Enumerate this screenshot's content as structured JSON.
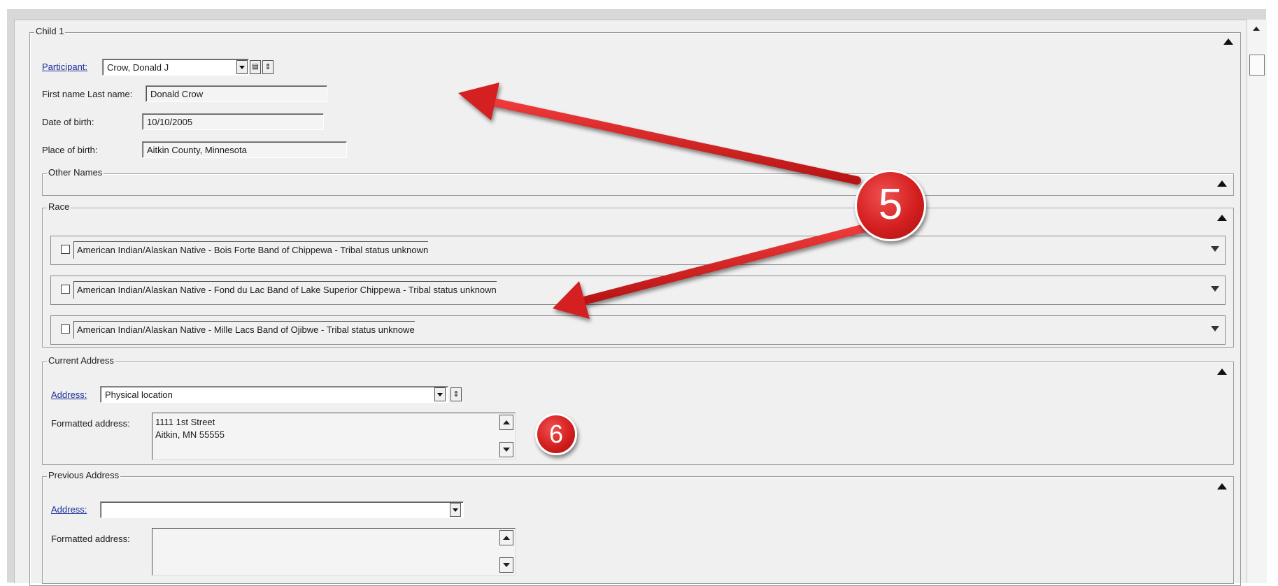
{
  "child": {
    "title": "Child 1",
    "participant": {
      "label": "Participant:",
      "value": "Crow, Donald J"
    },
    "name": {
      "label": "First name Last name:",
      "value": "Donald Crow"
    },
    "dob": {
      "label": "Date of birth:",
      "value": "10/10/2005"
    },
    "pob": {
      "label": "Place of birth:",
      "value": "Aitkin County, Minnesota"
    }
  },
  "other_names": {
    "title": "Other Names"
  },
  "race": {
    "title": "Race",
    "items": [
      {
        "label": "American Indian/Alaskan Native - Bois Forte Band of Chippewa - Tribal status unknown",
        "checked": false
      },
      {
        "label": "American Indian/Alaskan Native - Fond du Lac Band of Lake Superior Chippewa - Tribal status unknown",
        "checked": false
      },
      {
        "label": "American Indian/Alaskan Native - Mille Lacs Band of Ojibwe - Tribal status unknowe",
        "checked": false
      }
    ]
  },
  "current_address": {
    "title": "Current Address",
    "address_label": "Address:",
    "address_value": "Physical location",
    "formatted_label": "Formatted address:",
    "formatted_value": "1111 1st Street\nAitkin, MN 55555"
  },
  "previous_address": {
    "title": "Previous Address",
    "address_label": "Address:",
    "address_value": "",
    "formatted_label": "Formatted address:",
    "formatted_value": ""
  },
  "annotations": {
    "badge_main": "5",
    "badge_address": "6",
    "color": "#d42020"
  }
}
